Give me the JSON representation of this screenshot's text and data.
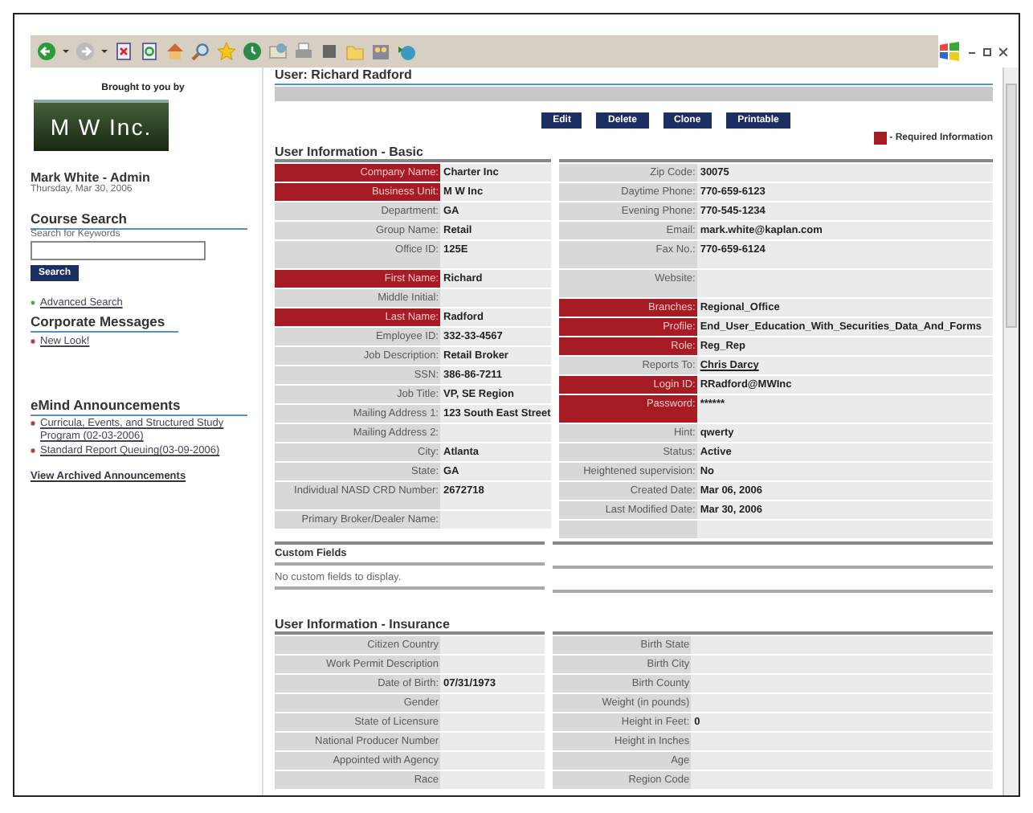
{
  "sidebar": {
    "sponsor_label": "Brought to you by",
    "logo": "M W Inc.",
    "user": "Mark White - Admin",
    "date": "Thursday, Mar 30, 2006",
    "course_search": {
      "title": "Course Search",
      "label": "Search for Keywords",
      "button": "Search",
      "link": "Advanced Search"
    },
    "corporate_messages": {
      "title": "Corporate Messages",
      "items": [
        "New Look!"
      ]
    },
    "announcements": {
      "title": "eMind  Announcements",
      "items": [
        "Curricula, Events, and Structured Study Program (02-03-2006)",
        "Standard Report Queuing(03-09-2006)"
      ],
      "archive_link": "View Archived Announcements"
    }
  },
  "page": {
    "title": "User: Richard Radford",
    "buttons": [
      "Edit",
      "Delete",
      "Clone",
      "Printable"
    ],
    "legend": "- Required Information",
    "basic": {
      "title": "User Information - Basic",
      "left": [
        {
          "label": "Company Name:",
          "value": "Charter Inc",
          "required": true,
          "kind": "text"
        },
        {
          "label": "Business Unit:",
          "value": "M W Inc",
          "required": true,
          "kind": "text"
        },
        {
          "label": "Department:",
          "value": "GA",
          "required": false,
          "kind": "text"
        },
        {
          "label": "Group Name:",
          "value": "Retail",
          "required": false,
          "kind": "text"
        },
        {
          "label": "Office ID:",
          "value": "125E",
          "required": false,
          "kind": "tall"
        },
        {
          "label": "First Name:",
          "value": "Richard",
          "required": true,
          "kind": "text"
        },
        {
          "label": "Middle Initial:",
          "required": false,
          "kind": "text"
        },
        {
          "label": "Last Name:",
          "value": "Radford",
          "required": true,
          "kind": "text"
        },
        {
          "label": "Employee ID:",
          "value": "332-33-4567",
          "required": false,
          "kind": "text"
        },
        {
          "label": "Job Description:",
          "value": "Retail Broker",
          "required": false,
          "kind": "text"
        },
        {
          "label": "SSN:",
          "value": "386-86-7211",
          "required": false,
          "kind": "text"
        },
        {
          "label": "Job Title:",
          "value": "VP, SE Region",
          "required": false,
          "kind": "text"
        },
        {
          "label": "Mailing Address 1:",
          "value": "123 South East Street",
          "required": false,
          "kind": "text"
        },
        {
          "label": "Mailing Address 2:",
          "required": false,
          "kind": "text"
        },
        {
          "label": "City:",
          "value": "Atlanta",
          "required": false,
          "kind": "text"
        },
        {
          "label": "State:",
          "value": "GA",
          "required": false,
          "kind": "text"
        },
        {
          "label": "Individual NASD CRD Number:",
          "value": "2672718",
          "required": false,
          "kind": "tall"
        },
        {
          "label": "Primary Broker/Dealer Name:",
          "required": false,
          "kind": "text"
        }
      ],
      "right": [
        {
          "label": "Zip Code:",
          "value": "30075",
          "required": false,
          "kind": "text"
        },
        {
          "label": "Daytime Phone:",
          "value": "770-659-6123",
          "required": false,
          "kind": "text"
        },
        {
          "label": "Evening Phone:",
          "value": "770-545-1234",
          "required": false,
          "kind": "text"
        },
        {
          "label": "Email:",
          "value": "mark.white@kaplan.com",
          "required": false,
          "kind": "text"
        },
        {
          "label": "Fax No.:",
          "value": "770-659-6124",
          "required": false,
          "kind": "tall"
        },
        {
          "label": "Website:",
          "required": false,
          "kind": "tall"
        },
        {
          "label": "Branches:",
          "value": "Regional_Office",
          "required": true,
          "kind": "text"
        },
        {
          "label": "Profile:",
          "value": "End_User_Education_With_Securities_Data_And_Forms",
          "required": true,
          "kind": "text"
        },
        {
          "label": "Role:",
          "value": "Reg_Rep",
          "required": true,
          "kind": "text"
        },
        {
          "label": "Reports To:",
          "value": "Chris Darcy",
          "required": false,
          "kind": "link"
        },
        {
          "label": "Login ID:",
          "value": "RRadford@MWInc",
          "required": true,
          "kind": "text"
        },
        {
          "label": "Password:",
          "value": "******",
          "required": true,
          "kind": "tall"
        },
        {
          "label": "Hint:",
          "value": "qwerty",
          "required": false,
          "kind": "text"
        },
        {
          "label": "Status:",
          "value": "Active",
          "required": false,
          "kind": "text"
        },
        {
          "label": "Heightened supervision:",
          "value": "No",
          "required": false,
          "kind": "text"
        },
        {
          "label": "Created Date:",
          "value": "Mar 06, 2006",
          "required": false,
          "kind": "text"
        },
        {
          "label": "Last Modified Date:",
          "value": "Mar 30, 2006",
          "required": false,
          "kind": "text"
        },
        {
          "required": false,
          "kind": "text"
        }
      ]
    },
    "custom_fields": {
      "title": "Custom Fields",
      "message": "No custom fields to display."
    },
    "insurance": {
      "title": "User Information - Insurance",
      "left": [
        {
          "label": "Citizen Country"
        },
        {
          "label": "Work Permit Description"
        },
        {
          "label": "Date of Birth:",
          "value": "07/31/1973"
        },
        {
          "label": "Gender"
        },
        {
          "label": "State of Licensure"
        },
        {
          "label": "National Producer Number"
        },
        {
          "label": "Appointed with Agency"
        },
        {
          "label": "Race"
        }
      ],
      "right": [
        {
          "label": "Birth State"
        },
        {
          "label": "Birth City"
        },
        {
          "label": "Birth County"
        },
        {
          "label": "Weight (in pounds)"
        },
        {
          "label": "Height in Feet:",
          "value": "0"
        },
        {
          "label": "Height in Inches"
        },
        {
          "label": "Age"
        },
        {
          "label": "Region Code"
        }
      ]
    }
  }
}
